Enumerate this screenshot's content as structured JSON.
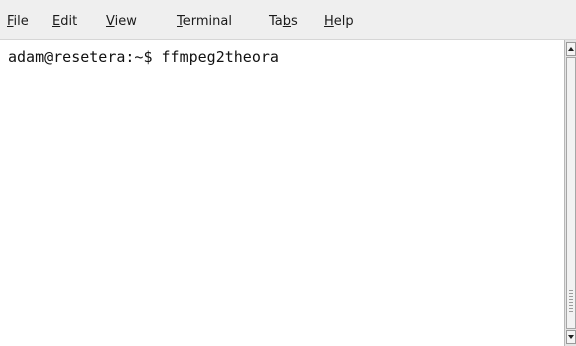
{
  "menubar": {
    "items": [
      {
        "label": "File",
        "mnemonic": "F",
        "rest": "ile"
      },
      {
        "label": "Edit",
        "mnemonic": "E",
        "rest": "dit"
      },
      {
        "label": "View",
        "mnemonic": "V",
        "rest": "iew"
      },
      {
        "label": "Terminal",
        "mnemonic": "T",
        "rest": "erminal"
      },
      {
        "label": "Tabs",
        "before": "Ta",
        "mnemonic": "b",
        "rest": "s"
      },
      {
        "label": "Help",
        "mnemonic": "H",
        "rest": "elp"
      }
    ]
  },
  "terminal": {
    "prompt": "adam@resetera:~$ ",
    "command": "ffmpeg2theora"
  },
  "scrollbar": {
    "up_icon": "arrow-up-icon",
    "down_icon": "arrow-down-icon"
  },
  "colors": {
    "menubar_bg": "#efefef",
    "terminal_bg": "#ffffff",
    "text": "#111111"
  }
}
